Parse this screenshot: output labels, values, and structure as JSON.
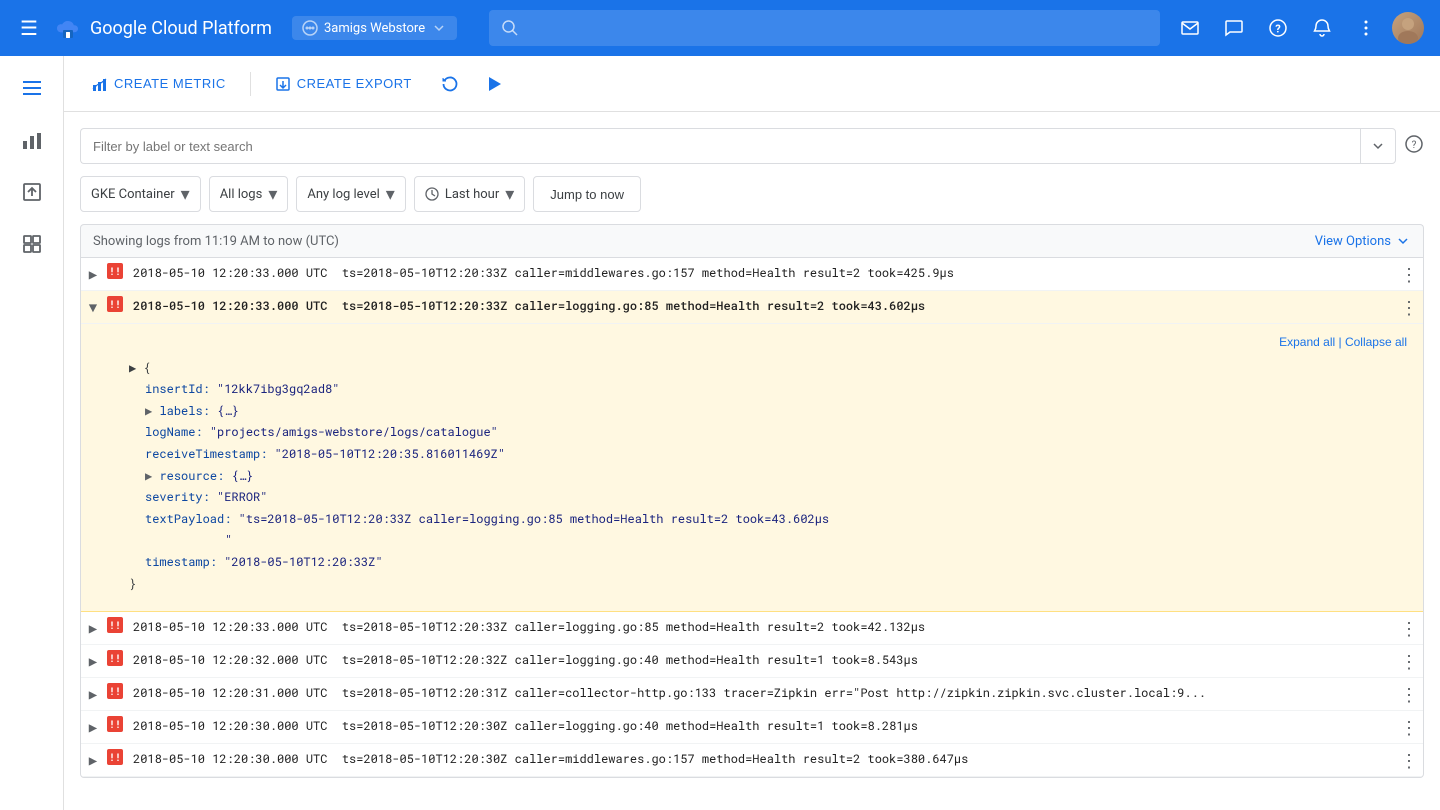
{
  "app": {
    "title": "Google Cloud Platform",
    "logo_text": "Google Cloud Platform"
  },
  "topnav": {
    "project": "3amigs Webstore",
    "search_placeholder": "",
    "icons": [
      "email",
      "chat",
      "help",
      "notifications",
      "more"
    ]
  },
  "sidebar": {
    "items": [
      {
        "id": "menu",
        "icon": "≡",
        "label": "Main menu"
      },
      {
        "id": "logs",
        "icon": "▤",
        "label": "Logs"
      },
      {
        "id": "metrics",
        "icon": "▦",
        "label": "Metrics"
      },
      {
        "id": "export",
        "icon": "↑",
        "label": "Export"
      },
      {
        "id": "resources",
        "icon": "▣",
        "label": "Resources"
      }
    ]
  },
  "toolbar": {
    "create_metric_label": "CREATE METRIC",
    "create_export_label": "CREATE EXPORT"
  },
  "filter": {
    "placeholder": "Filter by label or text search"
  },
  "controls": {
    "resource_dropdown": "GKE Container",
    "logs_dropdown": "All logs",
    "level_dropdown": "Any log level",
    "time_dropdown": "Last hour",
    "jump_now_label": "Jump to now",
    "view_options_label": "View Options"
  },
  "logs_bar": {
    "showing_text": "Showing logs from 11:19 AM to now (UTC)"
  },
  "expand_detail": {
    "expand_all_label": "Expand all",
    "collapse_all_label": "Collapse all",
    "separator": "|",
    "insert_id_label": "insertId:",
    "insert_id_value": "\"12kk7ibg3gq2ad8\"",
    "labels_label": "labels:",
    "labels_value": "{…}",
    "log_name_label": "logName:",
    "log_name_value": "\"projects/amigs-webstore/logs/catalogue\"",
    "receive_ts_label": "receiveTimestamp:",
    "receive_ts_value": "\"2018-05-10T12:20:35.816011469Z\"",
    "resource_label": "resource:",
    "resource_value": "{…}",
    "severity_label": "severity:",
    "severity_value": "\"ERROR\"",
    "text_payload_label": "textPayload:",
    "text_payload_value": "\"ts=2018-05-10T12:20:33Z caller=logging.go:85 method=Health result=2 took=43.602μs",
    "text_payload_cont": "\"",
    "timestamp_label": "timestamp:",
    "timestamp_value": "\"2018-05-10T12:20:33Z\""
  },
  "log_entries": [
    {
      "id": 1,
      "expanded": false,
      "severity": "error",
      "text": "2018-05-10 12:20:33.000 UTC  ts=2018-05-10T12:20:33Z caller=middlewares.go:157 method=Health result=2 took=425.9μs"
    },
    {
      "id": 2,
      "expanded": true,
      "severity": "error",
      "text": "2018-05-10 12:20:33.000 UTC  ts=2018-05-10T12:20:33Z caller=logging.go:85 method=Health result=2 took=43.602μs"
    },
    {
      "id": 3,
      "expanded": false,
      "severity": "error",
      "text": "2018-05-10 12:20:33.000 UTC  ts=2018-05-10T12:20:33Z caller=logging.go:85 method=Health result=2 took=42.132μs"
    },
    {
      "id": 4,
      "expanded": false,
      "severity": "error",
      "text": "2018-05-10 12:20:32.000 UTC  ts=2018-05-10T12:20:32Z caller=logging.go:40 method=Health result=1 took=8.543μs"
    },
    {
      "id": 5,
      "expanded": false,
      "severity": "error",
      "text": "2018-05-10 12:20:31.000 UTC  ts=2018-05-10T12:20:31Z caller=collector-http.go:133 tracer=Zipkin err=\"Post http://zipkin.zipkin.svc.cluster.local:9..."
    },
    {
      "id": 6,
      "expanded": false,
      "severity": "error",
      "text": "2018-05-10 12:20:30.000 UTC  ts=2018-05-10T12:20:30Z caller=logging.go:40 method=Health result=1 took=8.281μs"
    },
    {
      "id": 7,
      "expanded": false,
      "severity": "error",
      "text": "2018-05-10 12:20:30.000 UTC  ts=2018-05-10T12:20:30Z caller=middlewares.go:157 method=Health result=2 took=380.647μs"
    }
  ]
}
